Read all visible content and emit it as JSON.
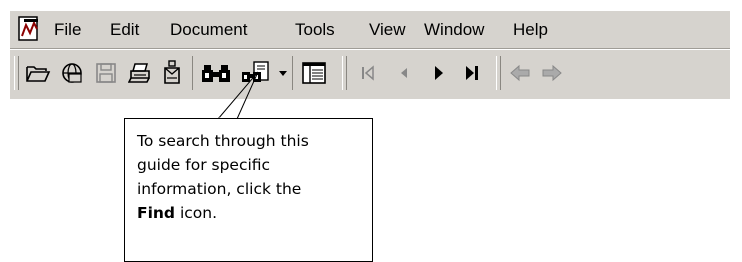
{
  "menubar": {
    "items": [
      "File",
      "Edit",
      "Document",
      "Tools",
      "View",
      "Window",
      "Help"
    ]
  },
  "toolbar": {
    "buttons": [
      {
        "icon": "open-folder-icon"
      },
      {
        "icon": "open-web-page-icon"
      },
      {
        "icon": "save-icon"
      },
      {
        "icon": "print-icon"
      },
      {
        "icon": "email-icon"
      },
      {
        "icon": "find-binoculars-icon"
      },
      {
        "icon": "search-documents-icon"
      },
      {
        "icon": "show-hide-navigation-pane-icon"
      },
      {
        "icon": "first-page-icon"
      },
      {
        "icon": "previous-page-icon"
      },
      {
        "icon": "next-page-icon"
      },
      {
        "icon": "last-page-icon"
      },
      {
        "icon": "go-back-icon"
      },
      {
        "icon": "go-forward-icon"
      }
    ]
  },
  "callout": {
    "line1": "To search through this",
    "line2": "guide for specific",
    "line3": "information, click the",
    "line4_bold": "Find",
    "line4_rest": " icon."
  }
}
